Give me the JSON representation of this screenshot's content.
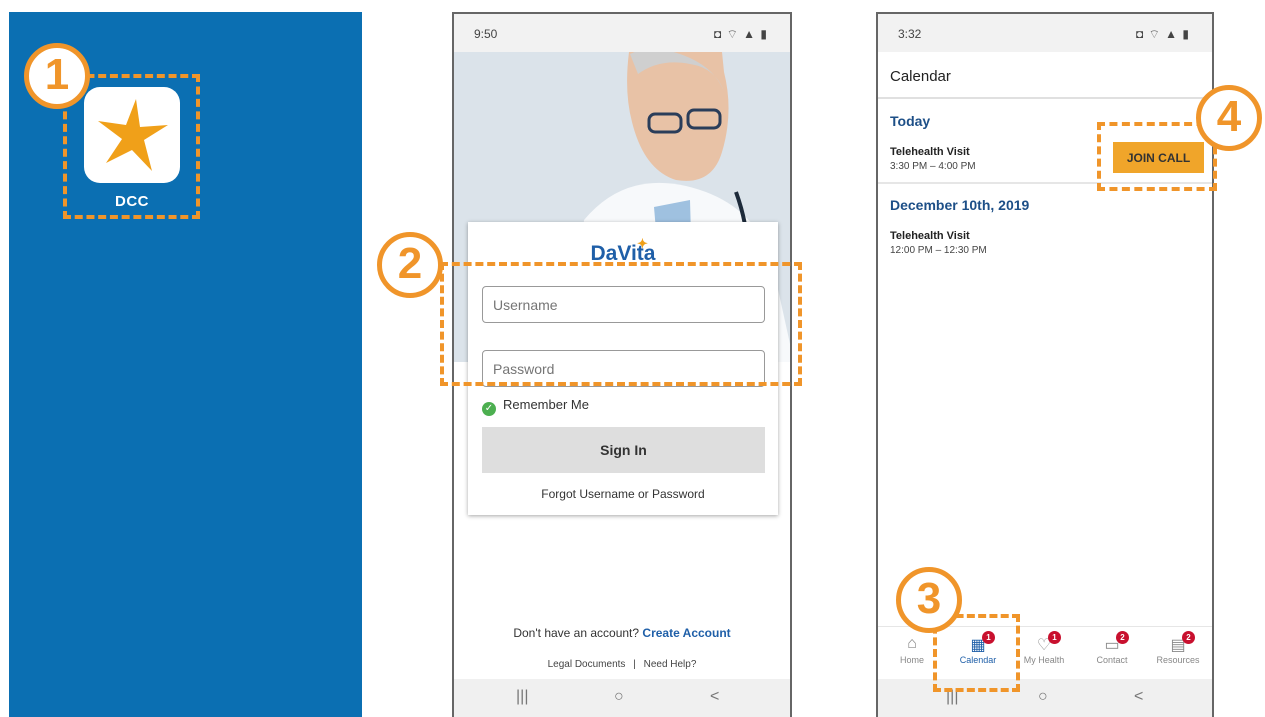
{
  "step_badges": [
    "1",
    "2",
    "3",
    "4"
  ],
  "app": {
    "label": "DCC",
    "icon": "star-logo-icon"
  },
  "login_screen": {
    "status_time": "9:50",
    "status_icons": "◘ ⌔ ▲ ▮",
    "logo_text": "DaVita",
    "username_placeholder": "Username",
    "password_placeholder": "Password",
    "remember_label": "Remember Me",
    "signin_label": "Sign In",
    "forgot_label": "Forgot Username or Password",
    "no_account_text": "Don't have an account?",
    "create_account_label": "Create Account",
    "legal_label": "Legal Documents",
    "legal_separator": "|",
    "help_label": "Need Help?"
  },
  "calendar_screen": {
    "status_time": "3:32",
    "status_icons": "◘ ⌔ ▲ ▮",
    "title": "Calendar",
    "today_label": "Today",
    "today_visit": {
      "title": "Telehealth Visit",
      "time": "3:30 PM – 4:00 PM"
    },
    "join_call_label": "JOIN CALL",
    "date_label": "December 10th, 2019",
    "date_visit": {
      "title": "Telehealth Visit",
      "time": "12:00 PM – 12:30 PM"
    },
    "tabs": [
      {
        "label": "Home",
        "badge": ""
      },
      {
        "label": "Calendar",
        "badge": "1"
      },
      {
        "label": "My Health",
        "badge": "1"
      },
      {
        "label": "Contact",
        "badge": "2"
      },
      {
        "label": "Resources",
        "badge": "2"
      }
    ]
  },
  "nav_glyphs": {
    "recents": "|||",
    "home": "○",
    "back": "<"
  },
  "colors": {
    "brand_blue": "#0b6fb2",
    "highlight_orange": "#f0952a",
    "davita_blue": "#1f5fa8",
    "join_button": "#f0a52a"
  }
}
